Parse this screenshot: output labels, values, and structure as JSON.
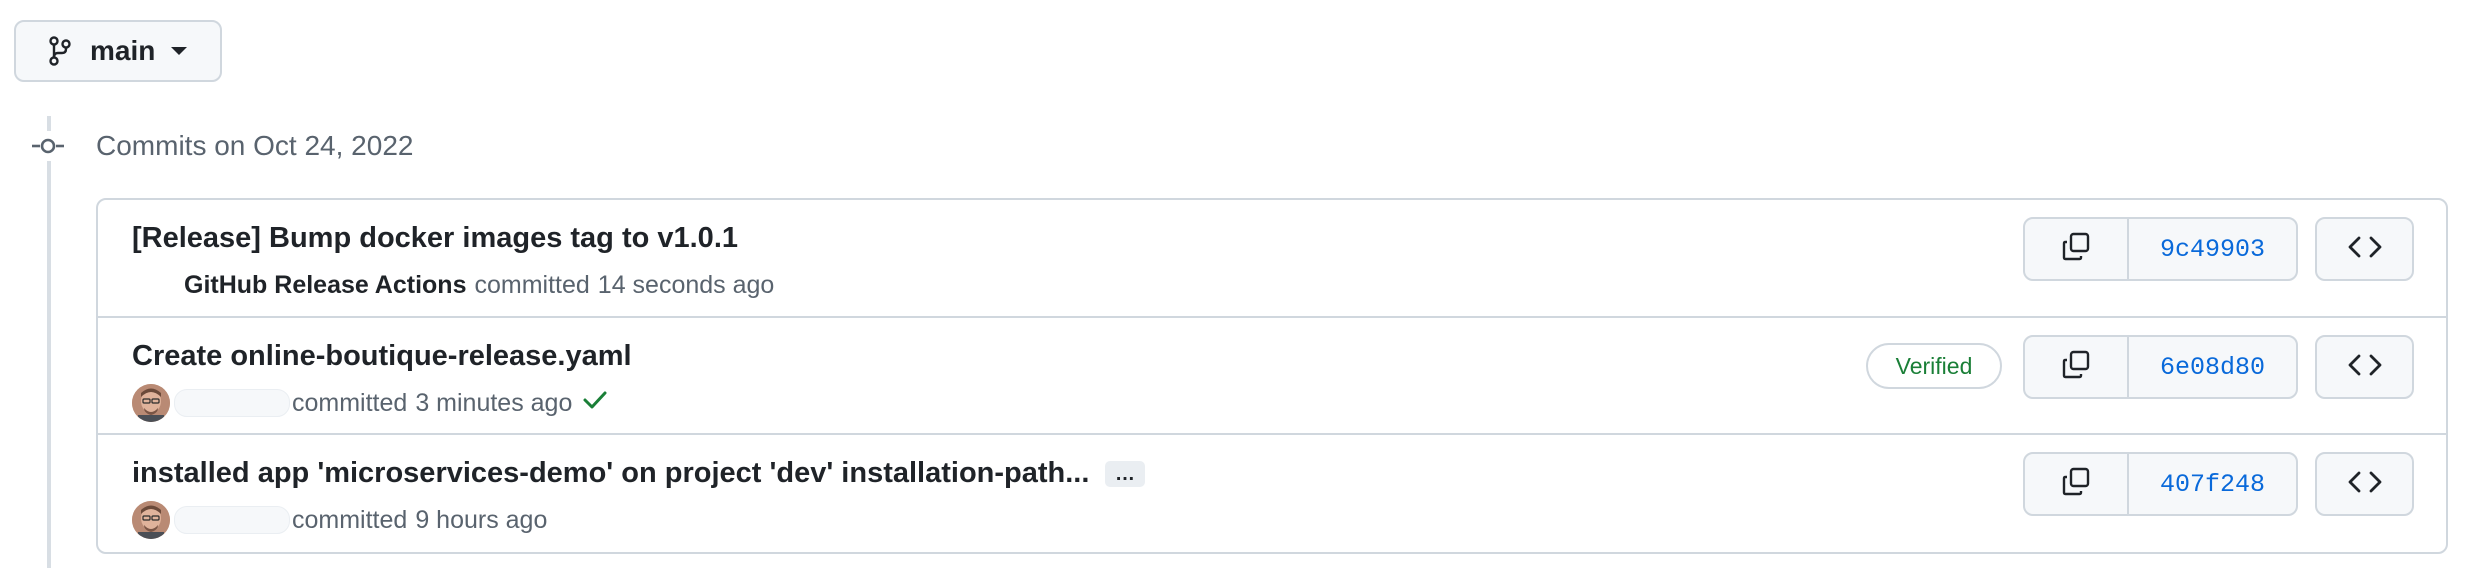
{
  "branch": {
    "name": "main"
  },
  "timeline": {
    "heading": "Commits on Oct 24, 2022"
  },
  "commits": [
    {
      "title": "[Release] Bump docker images tag to v1.0.1",
      "author": "GitHub Release Actions",
      "action": "committed",
      "time": "14 seconds ago",
      "sha": "9c49903",
      "verified": false,
      "status": "none"
    },
    {
      "title": "Create online-boutique-release.yaml",
      "author": "",
      "action": "committed",
      "time": "3 minutes ago",
      "sha": "6e08d80",
      "verified": true,
      "verified_label": "Verified",
      "status": "success"
    },
    {
      "title": "installed app 'microservices-demo' on project 'dev' installation-path...",
      "ellipsis": "…",
      "author": "",
      "action": "committed",
      "time": "9 hours ago",
      "sha": "407f248",
      "verified": false,
      "status": "none"
    }
  ],
  "icons": {
    "branch": "git-branch-icon",
    "caret": "caret-down-icon",
    "commit": "git-commit-icon",
    "copy": "copy-icon",
    "browse": "code-icon",
    "check": "check-icon"
  },
  "colors": {
    "link": "#0969da",
    "success": "#1a7f37",
    "border": "#d0d7de",
    "muted": "#59636e",
    "button_bg": "#f6f8fa"
  }
}
